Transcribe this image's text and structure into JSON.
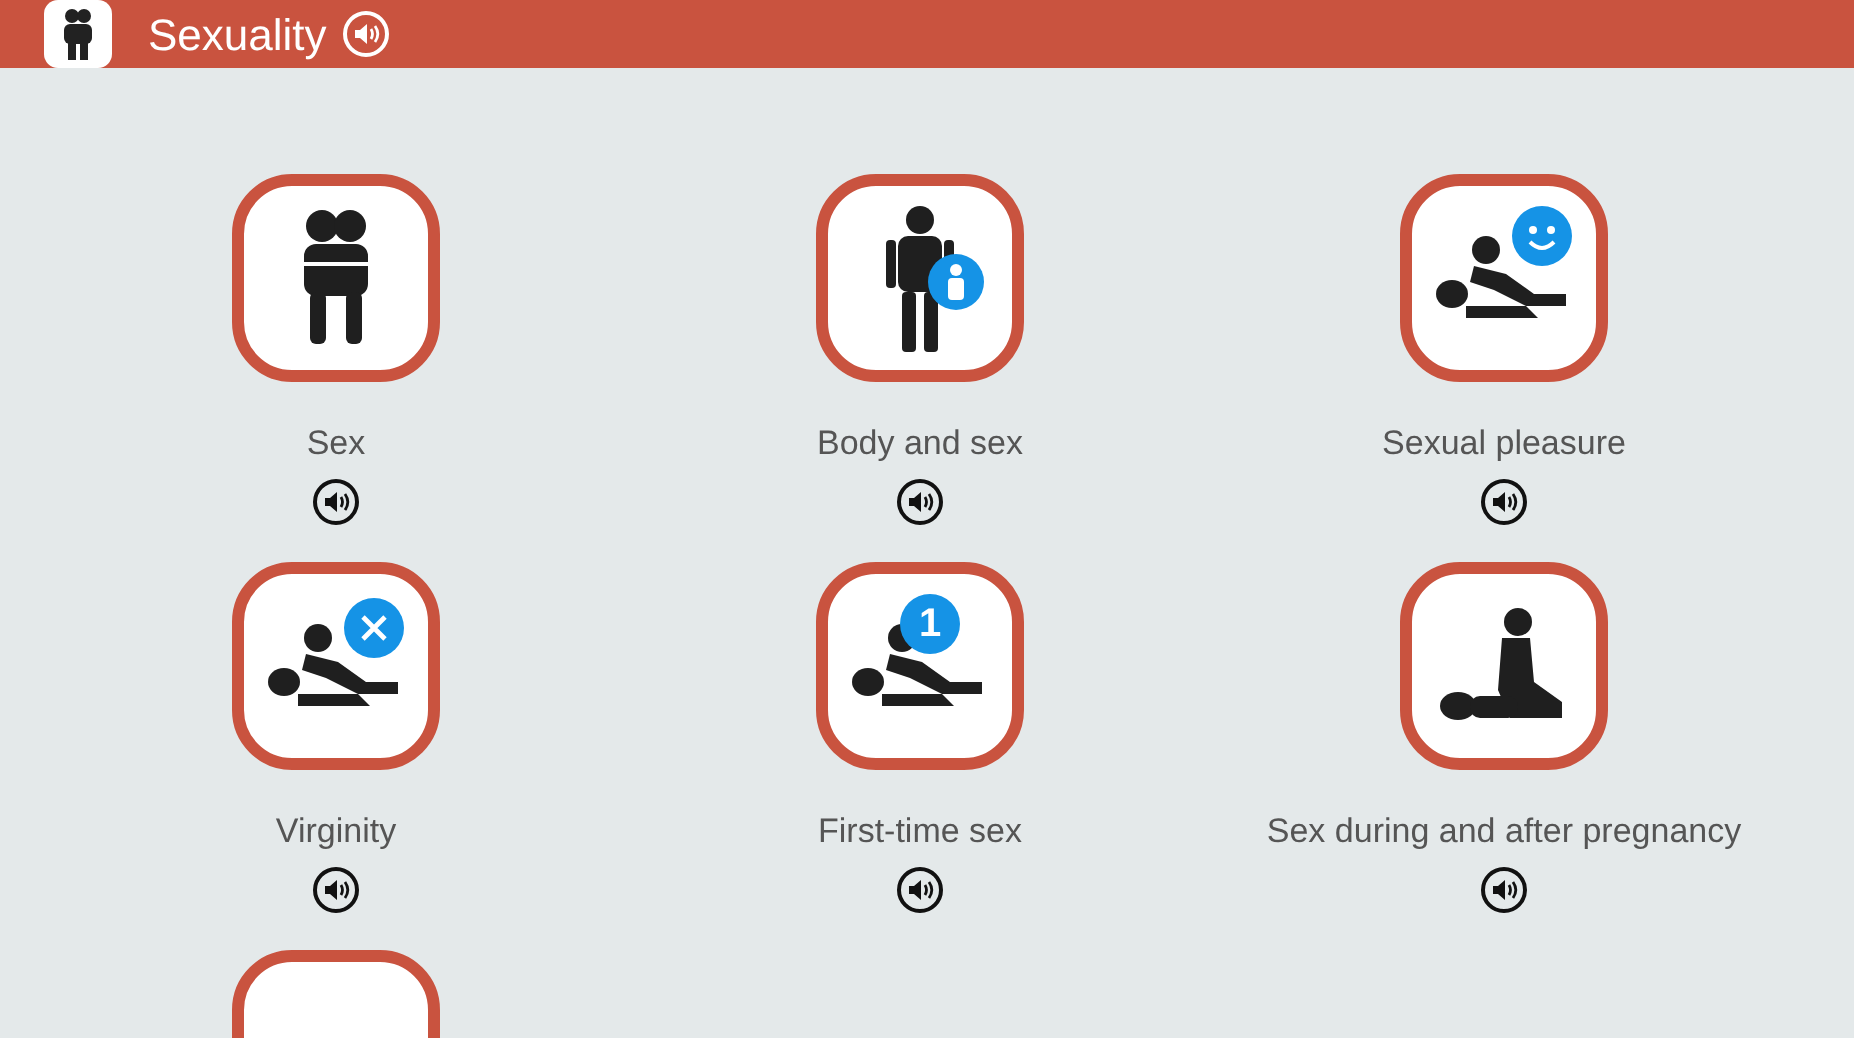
{
  "header": {
    "title": "Sexuality"
  },
  "topics": [
    {
      "label": "Sex",
      "kind": "hug"
    },
    {
      "label": "Body and sex",
      "kind": "body",
      "badge": {
        "kind": "figure"
      }
    },
    {
      "label": "Sexual pleasure",
      "kind": "lying",
      "badge": {
        "kind": "smile"
      }
    },
    {
      "label": "Virginity",
      "kind": "lying",
      "badge": {
        "kind": "cross"
      }
    },
    {
      "label": "First-time sex",
      "kind": "lying",
      "badge": {
        "kind": "number",
        "text": "1"
      }
    },
    {
      "label": "Sex during and after pregnancy",
      "kind": "kneeling"
    },
    {
      "kind": "hidden"
    }
  ]
}
